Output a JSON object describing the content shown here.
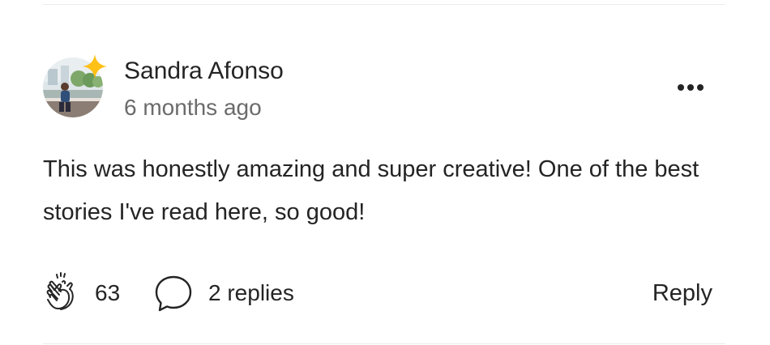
{
  "comment": {
    "author": "Sandra Afonso",
    "timestamp": "6 months ago",
    "body": "This was honestly amazing and super creative! One of the best stories I've read here, so good!",
    "clap_count": "63",
    "replies_label": "2 replies",
    "reply_label": "Reply"
  },
  "icons": {
    "avatar": "avatar-photo",
    "badge": "sparkle-icon",
    "more": "more-options-icon",
    "clap": "clap-icon",
    "comment": "comment-bubble-icon"
  },
  "colors": {
    "text_primary": "#242424",
    "text_secondary": "#6b6b6b",
    "sparkle": "#ffc017",
    "divider": "#ececec"
  }
}
